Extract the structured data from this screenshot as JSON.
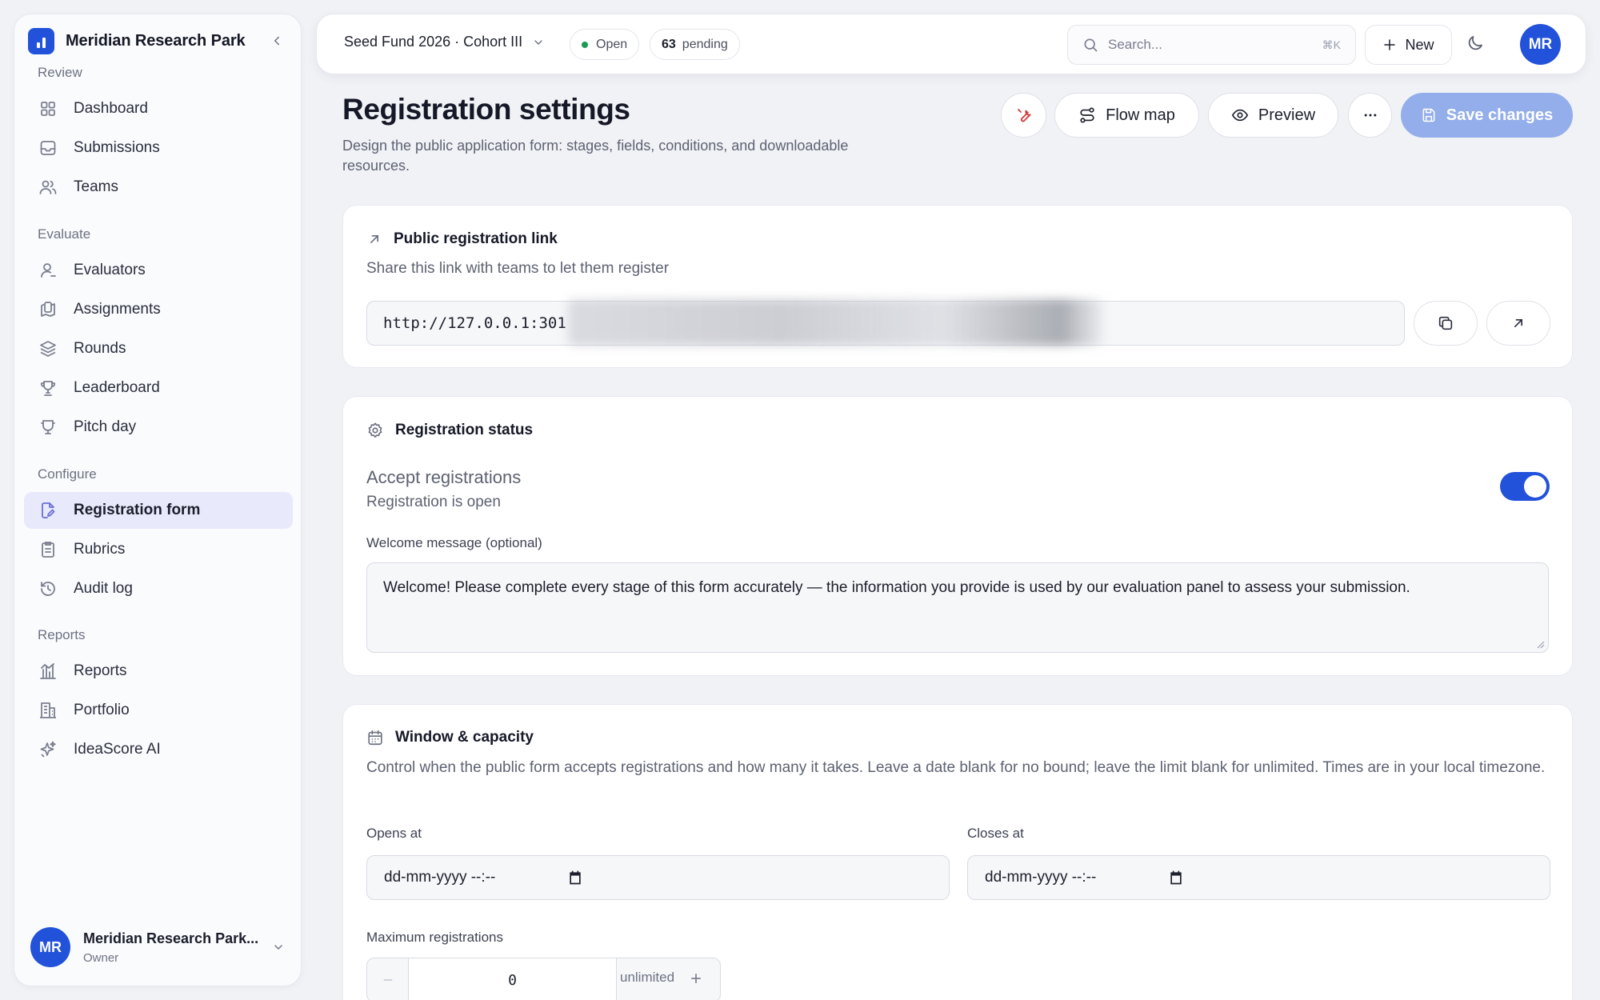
{
  "sidebar": {
    "brand": "Meridian Research Park",
    "sections": [
      "Review",
      "Evaluate",
      "Configure",
      "Reports"
    ],
    "items": [
      {
        "label": "Dashboard",
        "icon": "grid-icon"
      },
      {
        "label": "Submissions",
        "icon": "inbox-icon"
      },
      {
        "label": "Teams",
        "icon": "users-icon"
      },
      {
        "label": "Evaluators",
        "icon": "user-icon"
      },
      {
        "label": "Assignments",
        "icon": "clipboard-icon"
      },
      {
        "label": "Rounds",
        "icon": "layers-icon"
      },
      {
        "label": "Leaderboard",
        "icon": "trophy-icon"
      },
      {
        "label": "Pitch day",
        "icon": "presentation-icon"
      },
      {
        "label": "Registration form",
        "icon": "form-edit-icon",
        "active": true
      },
      {
        "label": "Rubrics",
        "icon": "list-check-icon"
      },
      {
        "label": "Audit log",
        "icon": "history-icon"
      },
      {
        "label": "Reports",
        "icon": "chart-icon"
      },
      {
        "label": "Portfolio",
        "icon": "building-icon"
      },
      {
        "label": "IdeaScore AI",
        "icon": "sparkles-icon"
      }
    ],
    "user": {
      "initials": "MR",
      "name": "Meridian Research Park...",
      "role": "Owner"
    }
  },
  "topbar": {
    "fund": "Seed Fund 2026 · Cohort III",
    "status": "Open",
    "pending_count": "63",
    "pending_label": "pending",
    "search_placeholder": "Search...",
    "search_shortcut": "⌘K",
    "new_label": "New",
    "avatar": "MR"
  },
  "page": {
    "title": "Registration settings",
    "description": "Design the public application form: stages, fields, conditions, and downloadable resources.",
    "actions": {
      "flow_map": "Flow map",
      "preview": "Preview",
      "save": "Save changes"
    }
  },
  "link_card": {
    "title": "Public registration link",
    "subtitle": "Share this link with teams to let them register",
    "url": "http://127.0.0.1:301"
  },
  "status_card": {
    "title": "Registration status",
    "toggle_label": "Accept registrations",
    "toggle_state": "Registration is open",
    "accepting": true,
    "welcome_label": "Welcome message (optional)",
    "welcome_text": "Welcome! Please complete every stage of this form accurately — the information you provide is used by our evaluation panel to assess your submission."
  },
  "window_card": {
    "title": "Window & capacity",
    "description": "Control when the public form accepts registrations and how many it takes. Leave a date blank for no bound; leave the limit blank for unlimited. Times are in your local timezone.",
    "opens_label": "Opens at",
    "opens_value": "dd-mm-yyyy --:--",
    "closes_label": "Closes at",
    "closes_value": "dd-mm-yyyy --:--",
    "max_label": "Maximum registrations",
    "max_value": "0",
    "max_hint": "unlimited"
  },
  "colors": {
    "accent": "#2152d9",
    "save_disabled": "#93aeea",
    "active_nav": "#e8e9fb",
    "status_dot": "#1c9a57"
  }
}
